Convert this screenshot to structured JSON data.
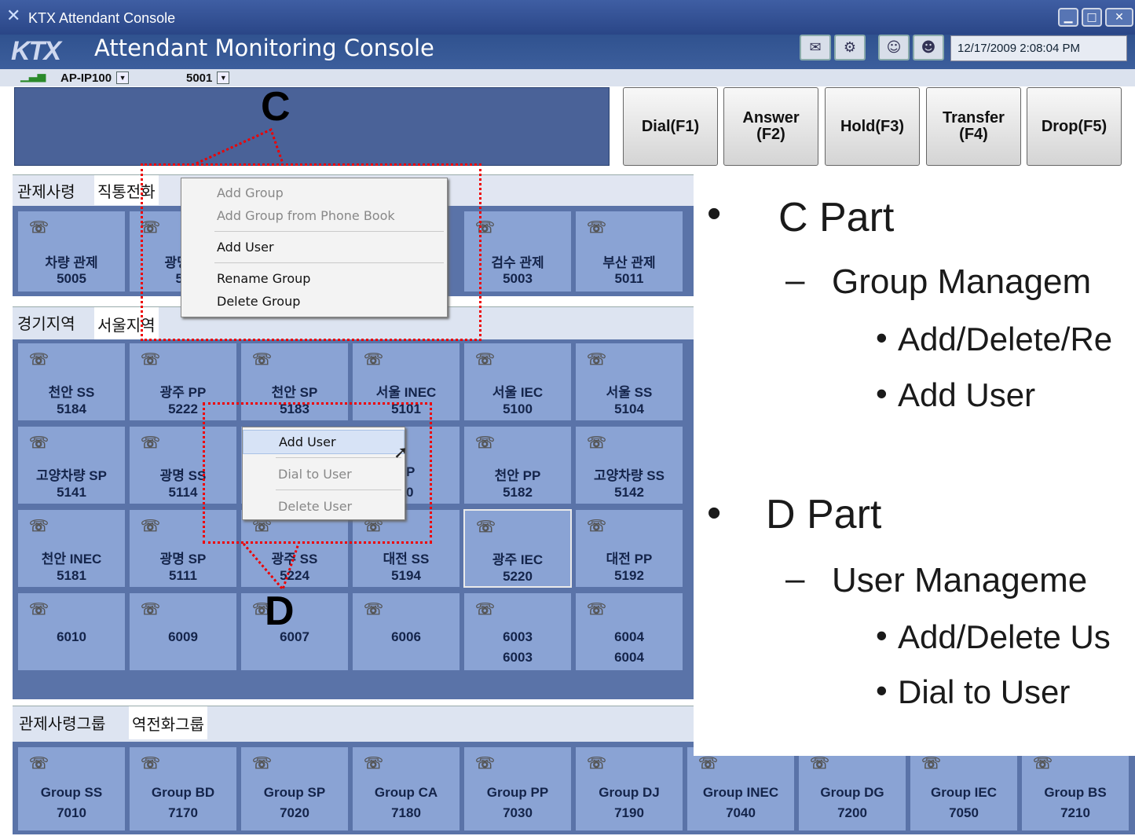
{
  "window": {
    "title": "KTX Attendant Console",
    "icon": "ktx-x-icon"
  },
  "header": {
    "brand": "KTX",
    "title": "Attendant Monitoring Console",
    "datetime": "12/17/2009 2:08:04 PM",
    "toolbar_icons": [
      "phonebook-icon",
      "settings-gear-icon",
      "users-icon",
      "network-users-icon"
    ]
  },
  "selectors": {
    "device": "AP-IP100",
    "extension": "5001",
    "signal_icon": "signal-bars-icon"
  },
  "function_buttons": [
    "Dial(F1)",
    "Answer\n(F2)",
    "Hold(F3)",
    "Transfer\n(F4)",
    "Drop(F5)"
  ],
  "annotations": {
    "c": "C",
    "d": "D"
  },
  "group_tabs_top": [
    "관제사령",
    "직통전화"
  ],
  "top_tiles": [
    {
      "name": "차량 관제",
      "num": "5005"
    },
    {
      "name": "광명전",
      "num": "50"
    },
    {
      "name": "검수 관제",
      "num": "5003"
    },
    {
      "name": "부산 관제",
      "num": "5011"
    }
  ],
  "context_menu_group": {
    "items": [
      "Add Group",
      "Add Group from Phone Book",
      "Add User",
      "Rename Group",
      "Delete Group"
    ],
    "disabled": [
      "Add Group",
      "Add Group from Phone Book"
    ]
  },
  "region_tabs": [
    "경기지역",
    "서울지역"
  ],
  "region_tiles": [
    [
      {
        "name": "천안 SS",
        "num": "5184"
      },
      {
        "name": "광주 PP",
        "num": "5222"
      },
      {
        "name": "천안 SP",
        "num": "5183"
      },
      {
        "name": "서울 INEC",
        "num": "5101"
      },
      {
        "name": "서울 IEC",
        "num": "5100"
      },
      {
        "name": "서울 SS",
        "num": "5104"
      }
    ],
    [
      {
        "name": "고양차량 SP",
        "num": "5141"
      },
      {
        "name": "광명 SS",
        "num": "5114"
      },
      {
        "name": "",
        "num": ""
      },
      {
        "name": "PP",
        "num": "10"
      },
      {
        "name": "천안 PP",
        "num": "5182"
      },
      {
        "name": "고양차량 SS",
        "num": "5142"
      }
    ],
    [
      {
        "name": "천안 INEC",
        "num": "5181"
      },
      {
        "name": "광명 SP",
        "num": "5111"
      },
      {
        "name": "광주 SS",
        "num": "5224"
      },
      {
        "name": "대전 SS",
        "num": "5194"
      },
      {
        "name": "광주 IEC",
        "num": "5220"
      },
      {
        "name": "대전 PP",
        "num": "5192"
      }
    ],
    [
      {
        "name": "6010",
        "num": ""
      },
      {
        "name": "6009",
        "num": ""
      },
      {
        "name": "6007",
        "num": ""
      },
      {
        "name": "6006",
        "num": ""
      },
      {
        "name": "6003",
        "num": "6003"
      },
      {
        "name": "6004",
        "num": "6004"
      }
    ]
  ],
  "context_menu_user": {
    "items": [
      "Add User",
      "Dial to User",
      "Delete User"
    ],
    "disabled": [
      "Dial to User",
      "Delete User"
    ]
  },
  "bottom_tabs": [
    "관제사령그룹",
    "역전화그룹"
  ],
  "bottom_tiles": [
    {
      "name": "Group SS",
      "num": "7010"
    },
    {
      "name": "Group BD",
      "num": "7170"
    },
    {
      "name": "Group SP",
      "num": "7020"
    },
    {
      "name": "Group CA",
      "num": "7180"
    },
    {
      "name": "Group PP",
      "num": "7030"
    },
    {
      "name": "Group DJ",
      "num": "7190"
    },
    {
      "name": "Group INEC",
      "num": "7040"
    },
    {
      "name": "Group DG",
      "num": "7200"
    },
    {
      "name": "Group IEC",
      "num": "7050"
    },
    {
      "name": "Group BS",
      "num": "7210"
    }
  ],
  "slide": {
    "c_part": "C Part",
    "c_sub": "Group Managem",
    "c_items": [
      "Add/Delete/Re",
      "Add User"
    ],
    "d_part": "D Part",
    "d_sub": "User Manageme",
    "d_items": [
      "Add/Delete Us",
      "Dial to User"
    ],
    "bullet": "•",
    "dash": "–"
  },
  "colors": {
    "panel": "#5a73a8",
    "tile": "#8aa3d4",
    "titlebar": "#2a4687",
    "annotation": "#e00000"
  }
}
